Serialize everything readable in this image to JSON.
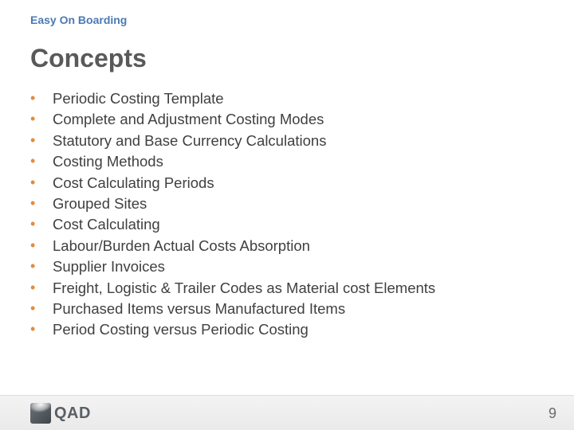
{
  "header": {
    "label": "Easy On Boarding"
  },
  "title": "Concepts",
  "bullets": [
    "Periodic Costing Template",
    "Complete and Adjustment Costing Modes",
    "Statutory and Base Currency Calculations",
    "Costing Methods",
    "Cost Calculating Periods",
    "Grouped Sites",
    "Cost Calculating",
    "Labour/Burden Actual Costs Absorption",
    "Supplier Invoices",
    "Freight, Logistic & Trailer Codes as Material cost Elements",
    "Purchased Items versus Manufactured Items",
    "Period Costing versus Periodic Costing"
  ],
  "footer": {
    "logo_text": "QAD",
    "page_number": "9"
  }
}
